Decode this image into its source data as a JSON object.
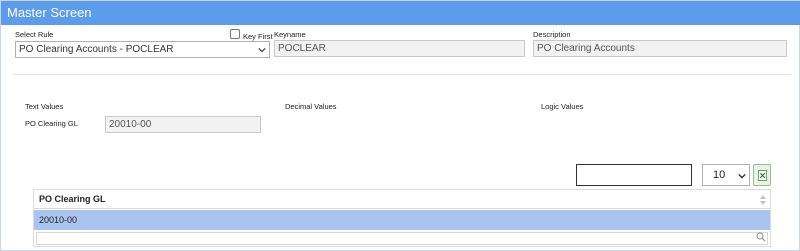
{
  "window": {
    "title": "Master Screen"
  },
  "header_fields": {
    "select_rule_label": "Select Rule",
    "select_rule_value": "PO Clearing Accounts - POCLEAR",
    "key_first_label": "Key First",
    "keyname_label": "Keyname",
    "keyname_value": "POCLEAR",
    "description_label": "Description",
    "description_value": "PO Clearing Accounts"
  },
  "values_section": {
    "text_values_label": "Text Values",
    "decimal_values_label": "Decimal Values",
    "logic_values_label": "Logic Values",
    "po_clearing_gl_label": "PO Clearing GL",
    "po_clearing_gl_value": "20010-00"
  },
  "table_controls": {
    "search_value": "",
    "page_size": "10",
    "export_icon": "excel-icon"
  },
  "grid": {
    "columns": [
      "PO Clearing GL"
    ],
    "rows": [
      [
        "20010-00"
      ]
    ]
  },
  "colors": {
    "titlebar": "#5b9ced",
    "selected_row": "#a9c5ef"
  }
}
